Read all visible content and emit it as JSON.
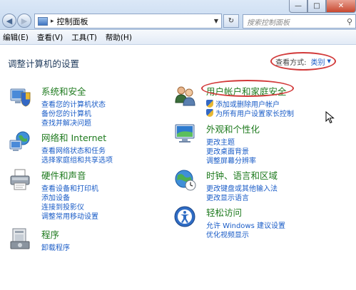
{
  "window": {
    "minimize_glyph": "—",
    "maximize_glyph": "□",
    "close_glyph": "✕"
  },
  "nav": {
    "back_glyph": "◀",
    "forward_glyph": "▶"
  },
  "address": {
    "separator": "▸",
    "path": "控制面板",
    "dropdown_glyph": "▼"
  },
  "refresh_glyph": "↻",
  "search": {
    "placeholder": "搜索控制面板",
    "icon": "search-icon",
    "glyph": "⚲"
  },
  "menu": [
    "编辑(E)",
    "查看(V)",
    "工具(T)",
    "帮助(H)"
  ],
  "page_title": "调整计算机的设置",
  "view_by": {
    "label": "查看方式:",
    "value": "类别",
    "arrow": "▼"
  },
  "sections": {
    "system": {
      "title": "系统和安全",
      "icon": "shield-pc-icon",
      "links": [
        "查看您的计算机状态",
        "备份您的计算机",
        "查找并解决问题"
      ]
    },
    "network": {
      "title": "网络和 Internet",
      "icon": "network-globe-icon",
      "links": [
        "查看网络状态和任务",
        "选择家庭组和共享选项"
      ]
    },
    "hardware": {
      "title": "硬件和声音",
      "icon": "printer-icon",
      "links": [
        "查看设备和打印机",
        "添加设备",
        "连接到投影仪",
        "调整常用移动设置"
      ]
    },
    "programs": {
      "title": "程序",
      "icon": "programs-icon",
      "links": [
        "卸载程序"
      ]
    },
    "users": {
      "title": "用户帐户和家庭安全",
      "icon": "users-icon",
      "links": [
        "添加或删除用户帐户",
        "为所有用户设置家长控制"
      ]
    },
    "appearance": {
      "title": "外观和个性化",
      "icon": "monitor-icon",
      "links": [
        "更改主题",
        "更改桌面背景",
        "调整屏幕分辨率"
      ]
    },
    "clock": {
      "title": "时钟、语言和区域",
      "icon": "globe-clock-icon",
      "links": [
        "更改键盘或其他输入法",
        "更改显示语言"
      ]
    },
    "access": {
      "title": "轻松访问",
      "icon": "ease-of-access-icon",
      "links": [
        "允许 Windows 建议设置",
        "优化视频显示"
      ]
    }
  },
  "colors": {
    "title_green": "#1e7a1e",
    "link_blue": "#1a5cc7",
    "highlight_red": "#d23a3a"
  }
}
